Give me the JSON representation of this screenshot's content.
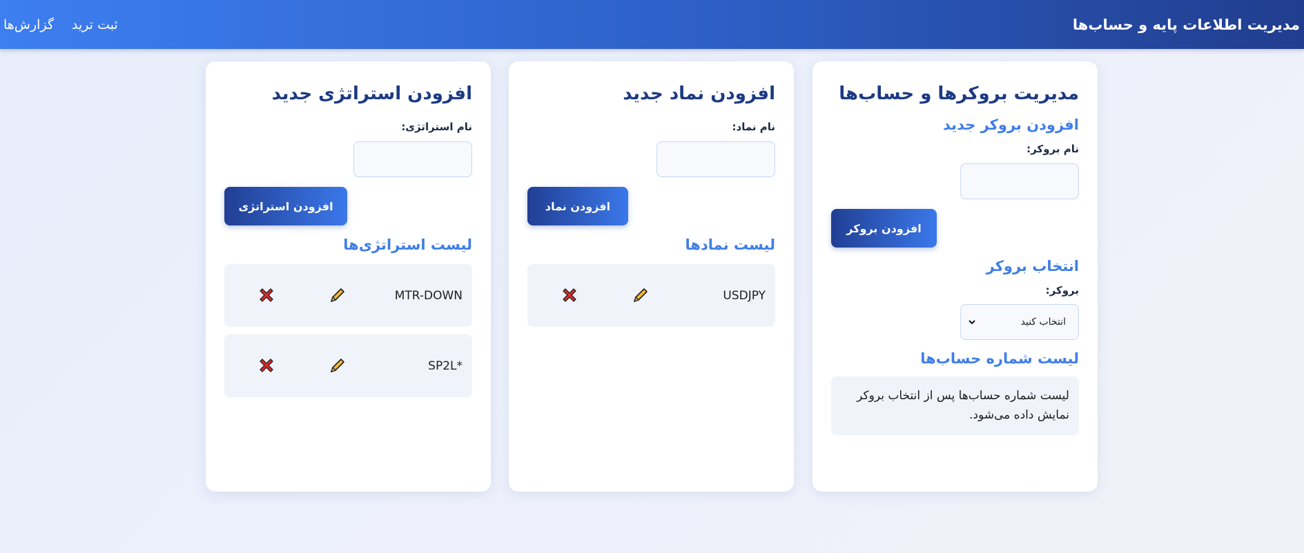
{
  "header": {
    "title": "مدیریت اطلاعات پایه و حساب‌ها",
    "nav": [
      "ثبت ترید",
      "گزارش‌ها"
    ]
  },
  "brokers_card": {
    "title": "مدیریت بروکرها و حساب‌ها",
    "add_heading": "افزودن بروکر جدید",
    "name_label": "نام بروکر:",
    "name_value": "",
    "add_button": "افزودن بروکر",
    "select_heading": "انتخاب بروکر",
    "broker_label": "بروکر:",
    "broker_selected": "انتخاب کنید",
    "accounts_heading": "لیست شماره حساب‌ها",
    "accounts_note": "لیست شماره حساب‌ها پس از انتخاب بروکر نمایش داده می‌شود."
  },
  "symbols_card": {
    "title": "افزودن نماد جدید",
    "name_label": "نام نماد:",
    "name_value": "",
    "add_button": "افزودن نماد",
    "list_heading": "لیست نمادها",
    "items": [
      {
        "name": "USDJPY"
      }
    ]
  },
  "strategies_card": {
    "title": "افزودن استراتژی جدید",
    "name_label": "نام استراتژی:",
    "name_value": "",
    "add_button": "افزودن استراتژی",
    "list_heading": "لیست استراتژی‌ها",
    "items": [
      {
        "name": "MTR-DOWN"
      },
      {
        "name": "SP2L*"
      }
    ]
  },
  "icons": {
    "edit": "pencil-icon",
    "delete": "close-x-icon"
  },
  "colors": {
    "header_start": "#3d7ef0",
    "header_end": "#213d8e",
    "heading_dark": "#1c3a84",
    "heading_accent": "#3f7ee6",
    "pencil": "#f5b731",
    "delete": "#d92b2b"
  }
}
